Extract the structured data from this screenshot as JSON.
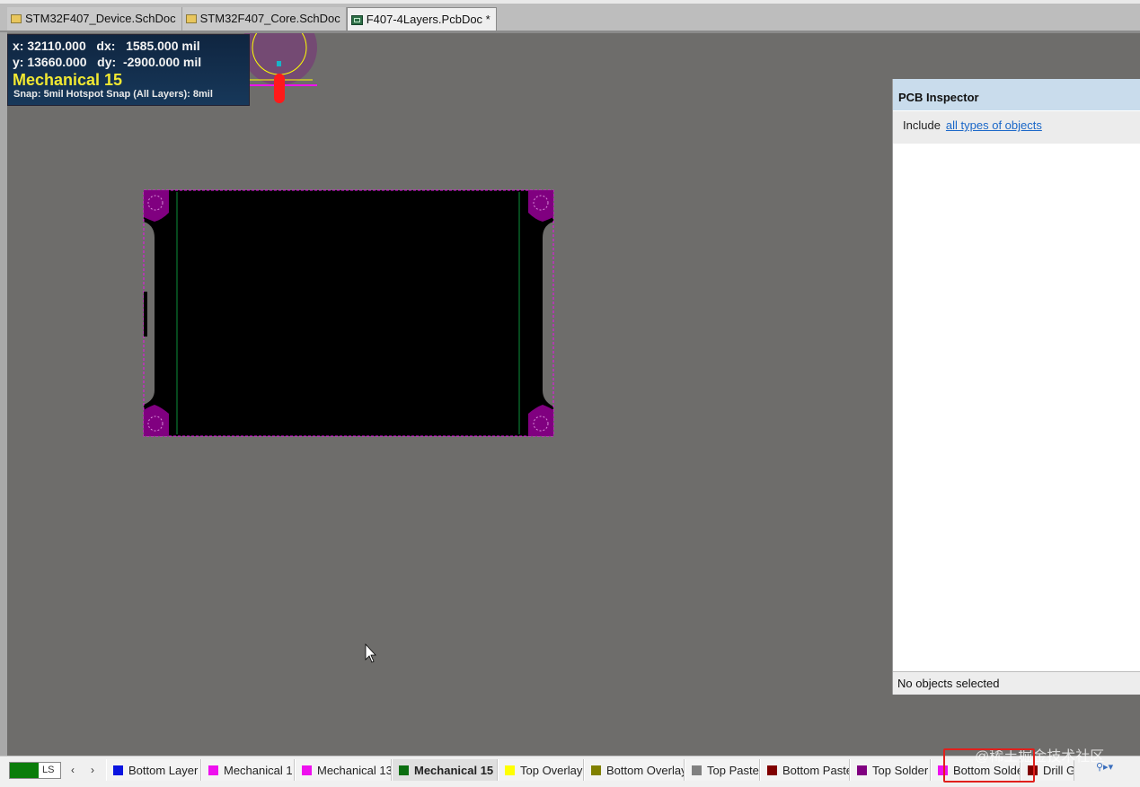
{
  "document_tabs": [
    {
      "label": "STM32F407_Device.SchDoc",
      "icon": "schematic-doc-icon",
      "active": false
    },
    {
      "label": "STM32F407_Core.SchDoc",
      "icon": "schematic-doc-icon",
      "active": false
    },
    {
      "label": "F407-4Layers.PcbDoc *",
      "icon": "pcb-doc-icon",
      "active": true
    }
  ],
  "hud": {
    "line1": "x: 32110.000   dx:   1585.000 mil",
    "line2": "y: 13660.000   dy:  -2900.000 mil",
    "layer": "Mechanical 15",
    "snap": "Snap: 5mil Hotspot Snap (All Layers): 8mil"
  },
  "inspector": {
    "title": "PCB Inspector",
    "include_label": "Include",
    "include_link": "all types of objects",
    "status": "No objects selected"
  },
  "layer_bar": {
    "ls_label": "LS",
    "ls_color": "#0a7d0a",
    "prev_icon": "chevron-left-icon",
    "next_icon": "chevron-right-icon",
    "layers": [
      {
        "name": "Bottom Layer",
        "color": "#0a14e0",
        "active": false
      },
      {
        "name": "Mechanical 1",
        "color": "#ee10ee",
        "active": false
      },
      {
        "name": "Mechanical 13",
        "color": "#ee10ee",
        "active": false
      },
      {
        "name": "Mechanical 15",
        "color": "#0a6e10",
        "active": true
      },
      {
        "name": "Top Overlay",
        "color": "#ffff00",
        "active": false
      },
      {
        "name": "Bottom Overlay",
        "color": "#808000",
        "active": false
      },
      {
        "name": "Top Paste",
        "color": "#808080",
        "active": false
      },
      {
        "name": "Bottom Paste",
        "color": "#800000",
        "active": false
      },
      {
        "name": "Top Solder",
        "color": "#800080",
        "active": false
      },
      {
        "name": "Bottom Solde",
        "color": "#ee10ee",
        "active": false
      },
      {
        "name": "Drill G",
        "color": "#800000",
        "active": false
      }
    ]
  },
  "watermark": "@稀土掘金技术社区",
  "colors": {
    "canvas": "#6e6d6b",
    "board": "#000000",
    "pad": "#800080",
    "outline": "#ee10ee",
    "highlight": "#e0201c"
  }
}
